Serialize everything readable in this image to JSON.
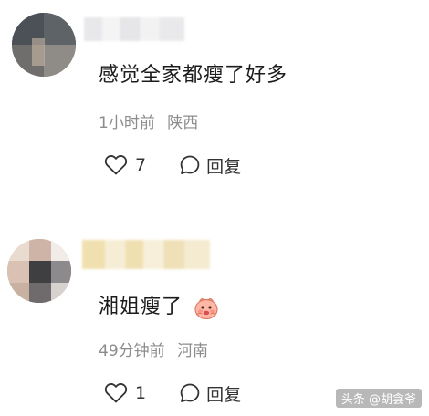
{
  "comments": [
    {
      "text": "感觉全家都瘦了好多",
      "time": "1小时前",
      "location": "陕西",
      "like_count": "7",
      "reply_label": "回复"
    },
    {
      "text": "湘姐瘦了",
      "emoji": "blushing-emoji",
      "time": "49分钟前",
      "location": "河南",
      "like_count": "1",
      "reply_label": "回复"
    }
  ],
  "watermark": "头条 @胡侌爷",
  "colors": {
    "text": "#1c1c1c",
    "meta": "#8c8c8c",
    "background": "#ffffff"
  }
}
